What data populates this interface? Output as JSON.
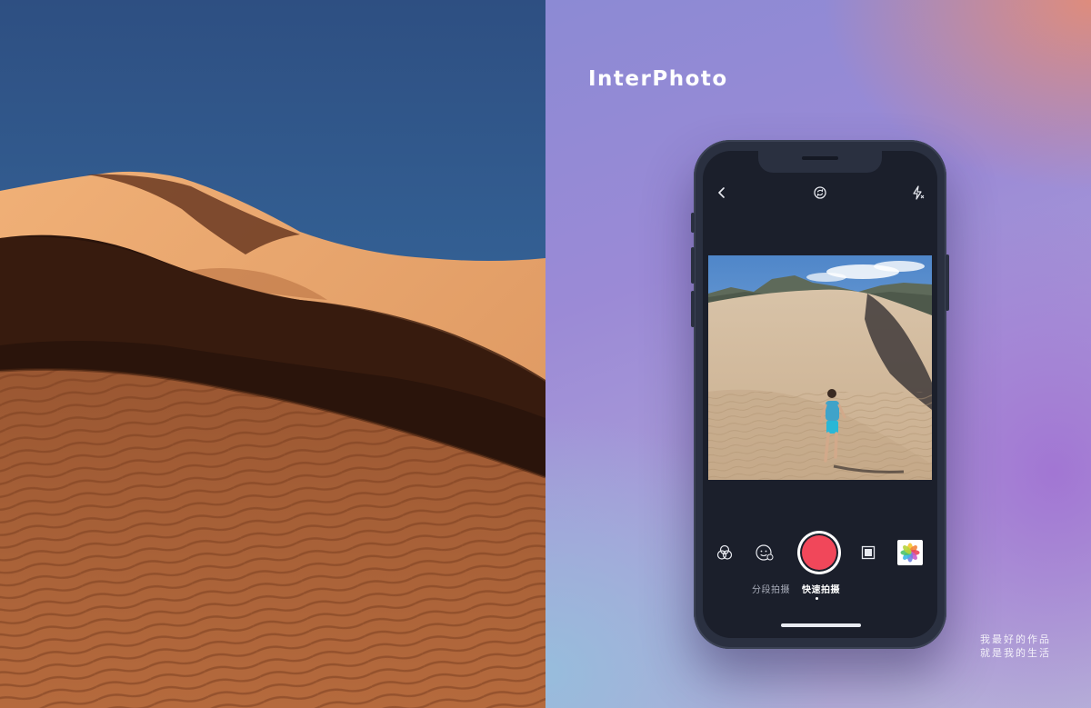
{
  "brand": {
    "title": "InterPhoto"
  },
  "slogan": {
    "line1": "我最好的作品",
    "line2": "就是我的生活"
  },
  "camera": {
    "top_bar": {
      "back_icon": "chevron-left-icon",
      "switch_icon": "camera-switch-icon",
      "flash_icon": "flash-off-icon"
    },
    "controls": {
      "filter_icon": "filter-circles-icon",
      "beauty_icon": "face-beauty-icon",
      "shutter_icon": "record-button",
      "ratio_icon": "square-ratio-icon",
      "gallery_icon": "photos-gallery-icon"
    },
    "modes": [
      {
        "label": "分段拍摄",
        "active": false
      },
      {
        "label": "快速拍摄",
        "active": true
      }
    ]
  },
  "colors": {
    "shutter": "#f1475a",
    "phone_body": "#2a3040",
    "screen": "#1b1f2b"
  }
}
